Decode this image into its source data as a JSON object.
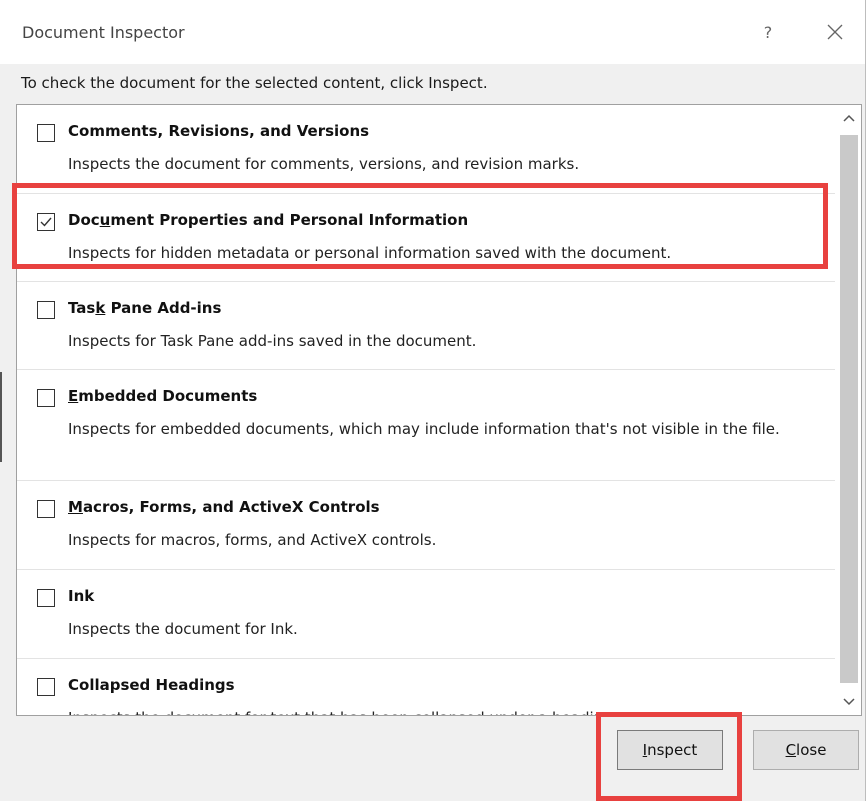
{
  "dialog": {
    "title": "Document Inspector",
    "help_label": "?",
    "instruction": "To check the document for the selected content, click Inspect."
  },
  "items": [
    {
      "title_pre": "Comments, Revisions, and Versions",
      "title_accel": "",
      "title_post": "",
      "description": "Inspects the document for comments, versions, and revision marks.",
      "checked": false
    },
    {
      "title_pre": "Doc",
      "title_accel": "u",
      "title_post": "ment Properties and Personal Information",
      "description": "Inspects for hidden metadata or personal information saved with the document.",
      "checked": true
    },
    {
      "title_pre": "Tas",
      "title_accel": "k",
      "title_post": " Pane Add-ins",
      "description": "Inspects for Task Pane add-ins saved in the document.",
      "checked": false
    },
    {
      "title_pre": "",
      "title_accel": "E",
      "title_post": "mbedded Documents",
      "description": "Inspects for embedded documents, which may include information that's not visible in the file.",
      "checked": false
    },
    {
      "title_pre": "",
      "title_accel": "M",
      "title_post": "acros, Forms, and ActiveX Controls",
      "description": "Inspects for macros, forms, and ActiveX controls.",
      "checked": false
    },
    {
      "title_pre": "Ink",
      "title_accel": "",
      "title_post": "",
      "description": "Inspects the document for Ink.",
      "checked": false
    },
    {
      "title_pre": "Collapsed Headings",
      "title_accel": "",
      "title_post": "",
      "description": "Inspects the document for text that has been collapsed under a heading.",
      "checked": false
    }
  ],
  "buttons": {
    "inspect_accel": "I",
    "inspect_rest": "nspect",
    "close_accel": "C",
    "close_rest": "lose"
  },
  "colors": {
    "highlight": "#e8413f",
    "title_bar": "#ffffff",
    "dialog_bg": "#f0f0f0"
  }
}
